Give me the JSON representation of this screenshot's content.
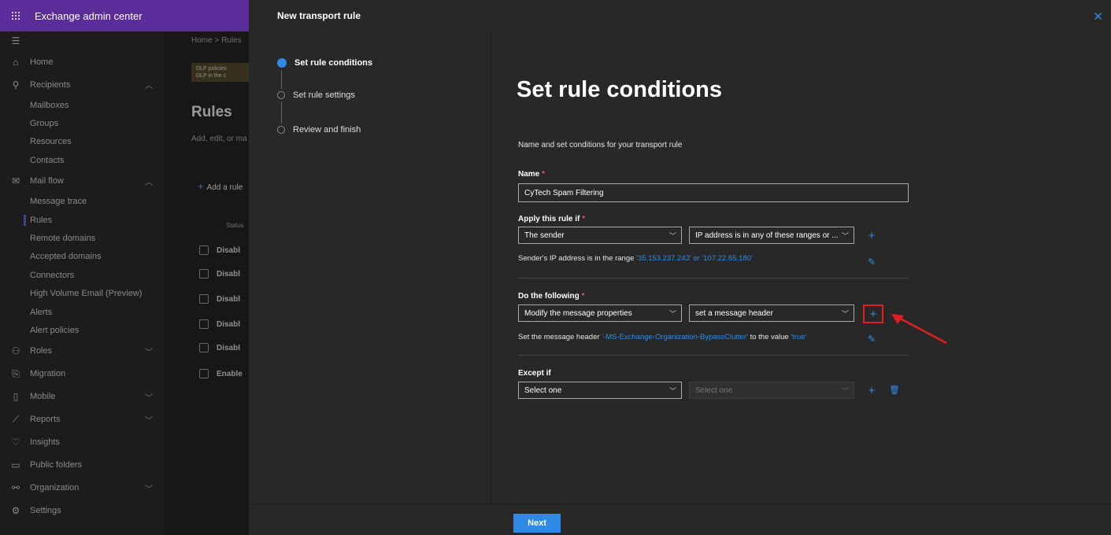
{
  "app": {
    "title": "Exchange admin center",
    "waffle_icon": "waffle-icon"
  },
  "nav": {
    "items": [
      {
        "label": "Home",
        "icon": "home-icon"
      },
      {
        "label": "Recipients",
        "icon": "person-icon",
        "expanded": true
      },
      {
        "label": "Mailboxes"
      },
      {
        "label": "Groups"
      },
      {
        "label": "Resources"
      },
      {
        "label": "Contacts"
      },
      {
        "label": "Mail flow",
        "icon": "mail-icon",
        "expanded": true
      },
      {
        "label": "Message trace"
      },
      {
        "label": "Rules",
        "active": true
      },
      {
        "label": "Remote domains"
      },
      {
        "label": "Accepted domains"
      },
      {
        "label": "Connectors"
      },
      {
        "label": "High Volume Email (Preview)"
      },
      {
        "label": "Alerts"
      },
      {
        "label": "Alert policies"
      },
      {
        "label": "Roles",
        "icon": "roles-icon"
      },
      {
        "label": "Migration",
        "icon": "migration-icon"
      },
      {
        "label": "Mobile",
        "icon": "mobile-icon"
      },
      {
        "label": "Reports",
        "icon": "reports-icon"
      },
      {
        "label": "Insights",
        "icon": "insights-icon"
      },
      {
        "label": "Public folders",
        "icon": "public-folders-icon"
      },
      {
        "label": "Organization",
        "icon": "organization-icon"
      },
      {
        "label": "Settings",
        "icon": "settings-icon"
      }
    ]
  },
  "background_page": {
    "breadcrumb": "Home  >  Rules",
    "info_line1": "DLP policies",
    "info_line2": "DLP in the c",
    "title": "Rules",
    "description": "Add, edit, or ma",
    "add_rule": "Add a rule",
    "status_header": "Status",
    "rows": [
      "Disabl",
      "Disabl",
      "Disabl",
      "Disabl",
      "Disabl",
      "Enable"
    ]
  },
  "panel": {
    "header": "New transport rule",
    "close_icon": "close-icon",
    "steps": [
      {
        "label": "Set rule conditions",
        "active": true
      },
      {
        "label": "Set rule settings"
      },
      {
        "label": "Review and finish"
      }
    ],
    "heading": "Set rule conditions",
    "subtitle": "Name and set conditions for your transport rule",
    "name": {
      "label": "Name",
      "required": "*",
      "value": "CyTech Spam Filtering"
    },
    "apply_if": {
      "label": "Apply this rule if",
      "required": "*",
      "select1": "The sender",
      "select2": "IP address is in any of these ranges or ...",
      "desc_prefix": "Sender's IP address is in the range ",
      "desc_value": "'35.153.237.243' or '107.22.65.180'"
    },
    "do_following": {
      "label": "Do the following",
      "required": "*",
      "select1": "Modify the message properties",
      "select2": "set a message header",
      "desc_prefix": "Set the message header ",
      "desc_header": "'-MS-Exchange-Organization-BypassClutter'",
      "desc_mid": " to the value ",
      "desc_value": "'true'"
    },
    "except_if": {
      "label": "Except if",
      "select1": "Select one",
      "select2": "Select one"
    },
    "next_button": "Next"
  },
  "colors": {
    "accent": "#2f8ae6",
    "brand_bar": "#5b2d9a",
    "highlight": "#e01f1f"
  }
}
